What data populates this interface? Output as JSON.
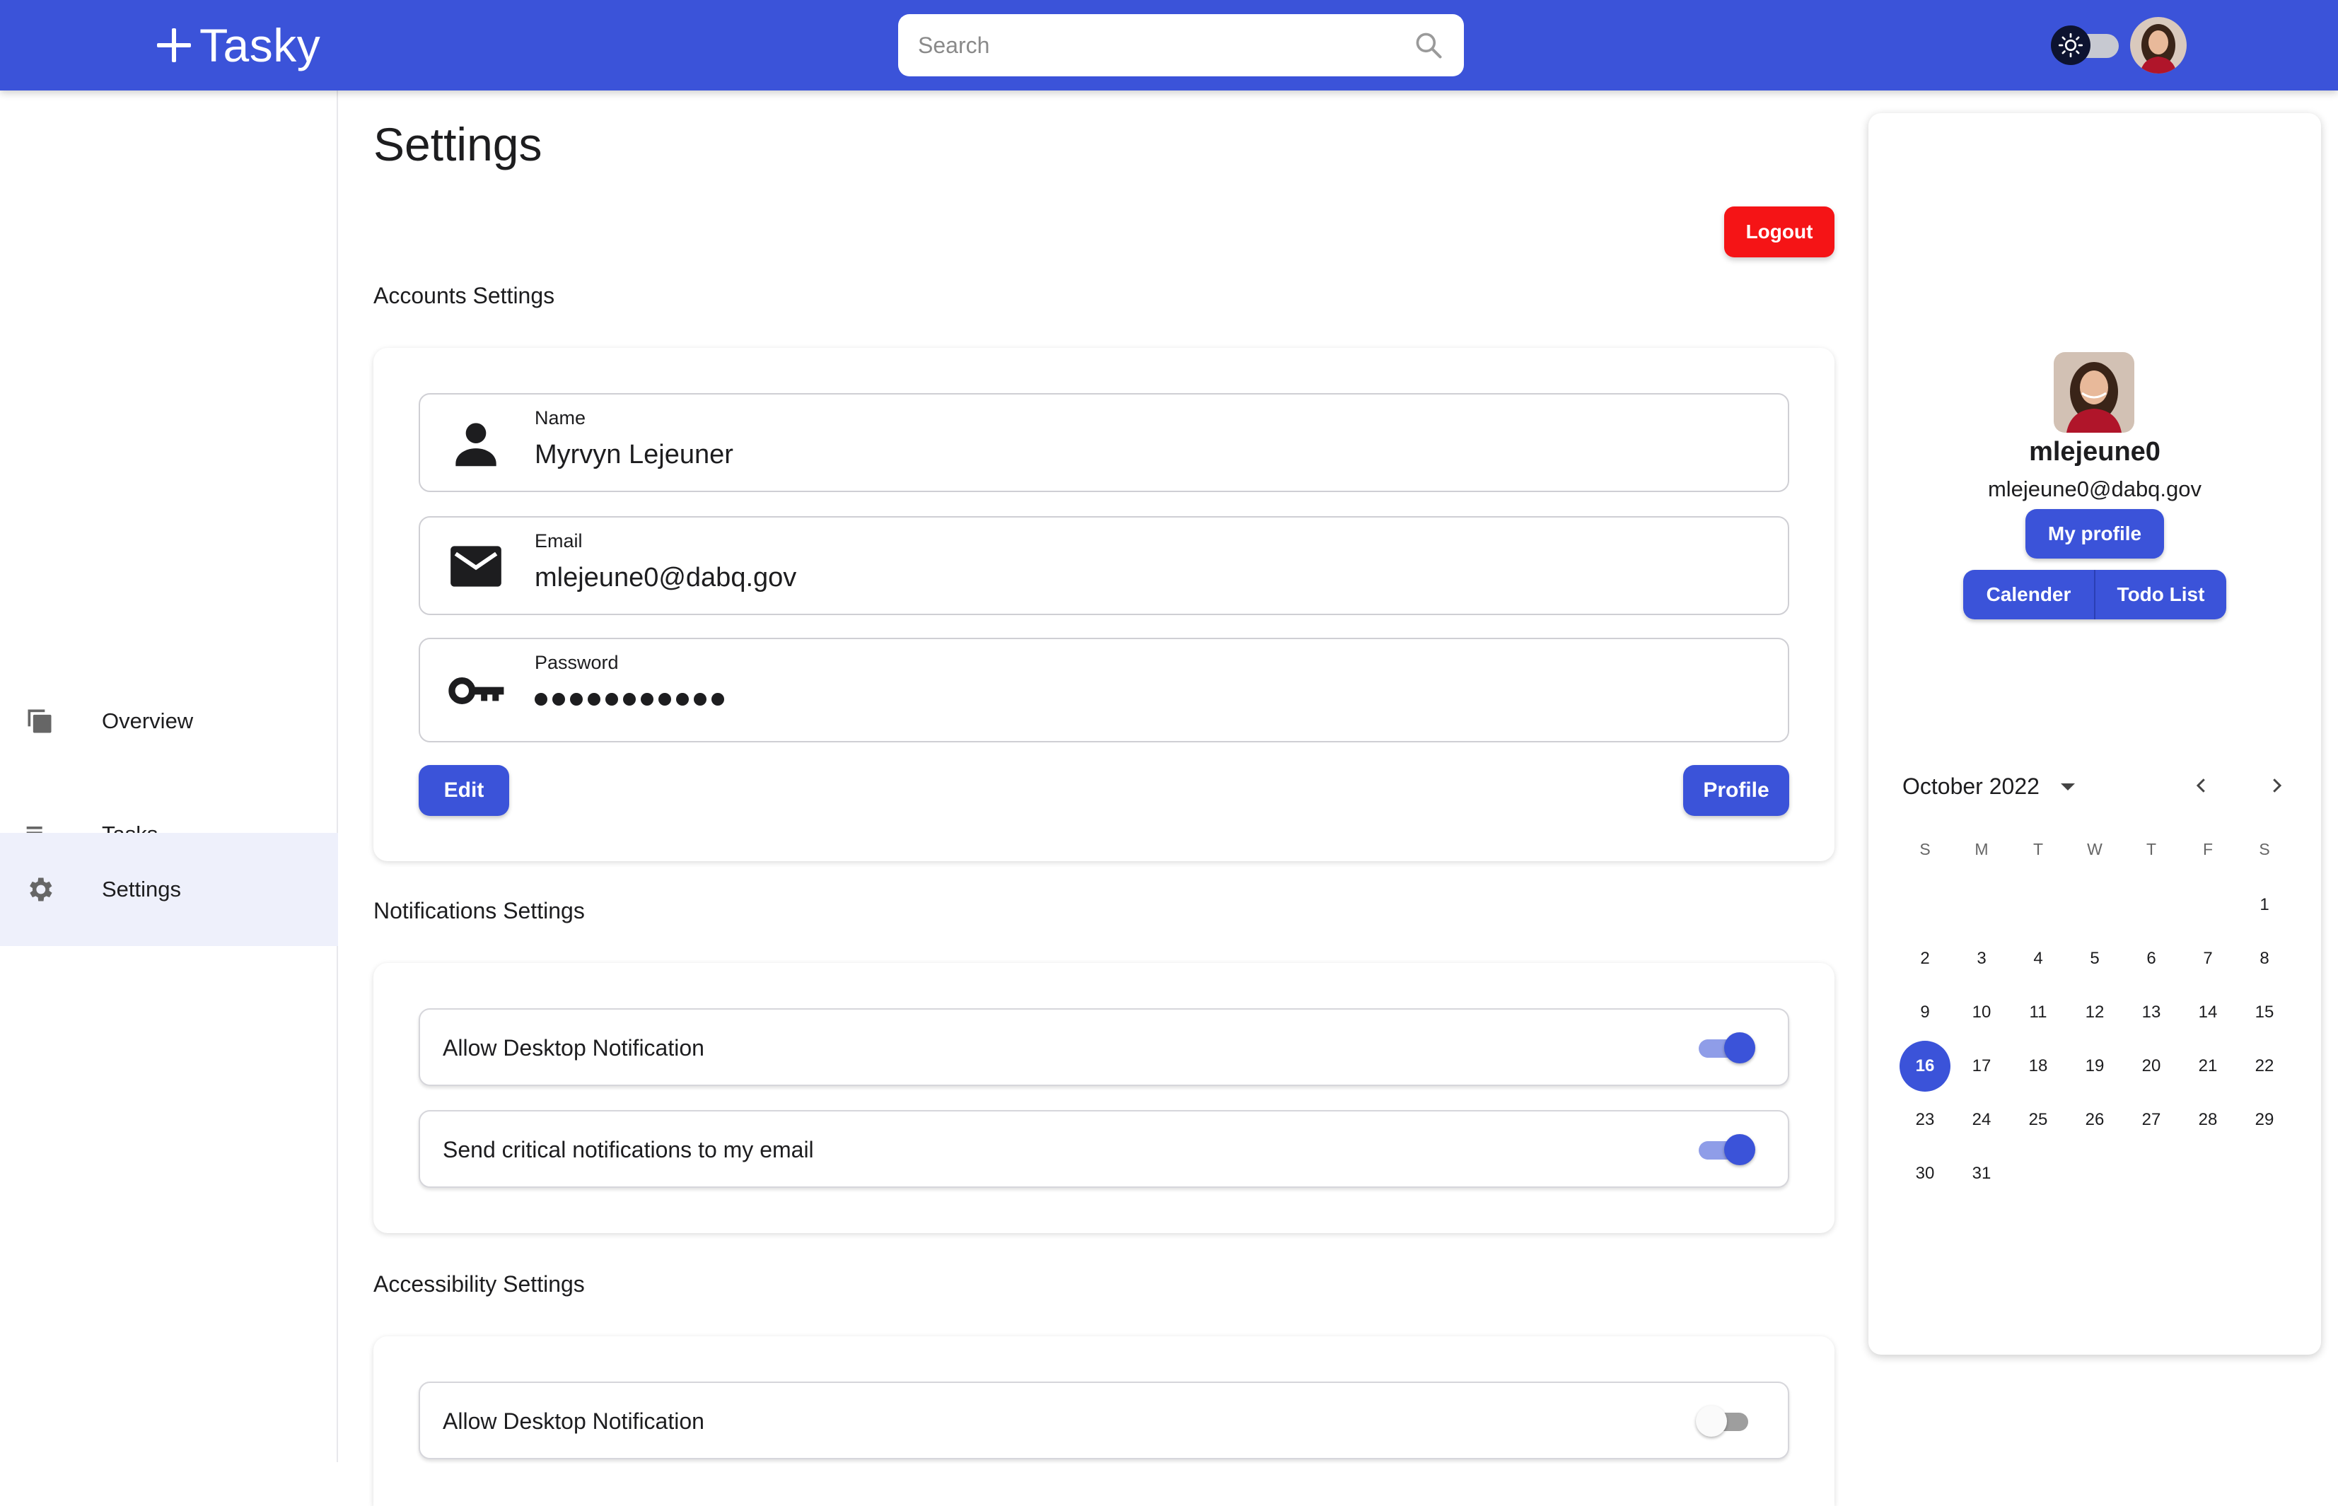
{
  "app": {
    "name": "Tasky"
  },
  "search": {
    "placeholder": "Search"
  },
  "sidebar": {
    "items": [
      {
        "label": "Overview",
        "icon": "library-icon",
        "active": false
      },
      {
        "label": "Tasks",
        "icon": "playlist-add-icon",
        "active": false
      },
      {
        "label": "Settings",
        "icon": "gear-icon",
        "active": true
      }
    ]
  },
  "main": {
    "title": "Settings",
    "logout_label": "Logout",
    "account": {
      "section_title": "Accounts Settings",
      "name_label": "Name",
      "name_value": "Myrvyn Lejeuner",
      "email_label": "Email",
      "email_value": "mlejeune0@dabq.gov",
      "password_label": "Password",
      "password_masked_length": 11,
      "edit_label": "Edit",
      "profile_label": "Profile"
    },
    "notifications": {
      "section_title": "Notifications Settings",
      "items": [
        {
          "label": "Allow Desktop Notification",
          "enabled": true
        },
        {
          "label": "Send critical notifications to my email",
          "enabled": true
        }
      ]
    },
    "accessibility": {
      "section_title": "Accessibility Settings",
      "items": [
        {
          "label": "Allow Desktop Notification",
          "enabled": false
        }
      ]
    }
  },
  "profile_panel": {
    "username": "mlejeune0",
    "email": "mlejeune0@dabq.gov",
    "my_profile_label": "My profile",
    "tabs": [
      "Calender",
      "Todo List"
    ],
    "calendar": {
      "month_label": "October 2022",
      "weekdays": [
        "S",
        "M",
        "T",
        "W",
        "T",
        "F",
        "S"
      ],
      "first_weekday_index": 6,
      "days_in_month": 31,
      "selected_day": 16
    }
  },
  "colors": {
    "primary": "#3b53d9",
    "danger": "#f51416",
    "active_nav_bg": "#eef0fb"
  }
}
